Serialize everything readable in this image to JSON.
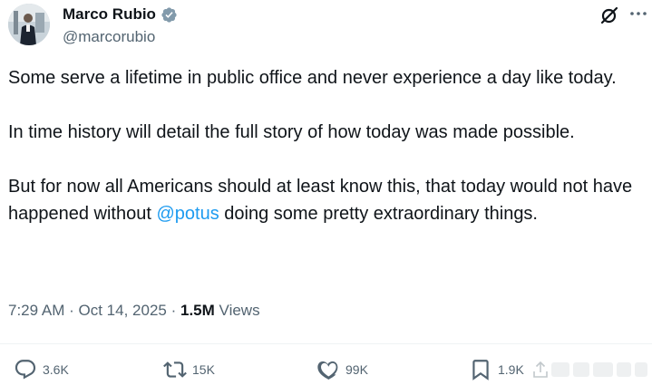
{
  "author": {
    "display_name": "Marco Rubio",
    "handle": "@marcorubio",
    "verified": true
  },
  "tweet": {
    "paragraph_1": "Some serve a lifetime in public office and never experience a day like today.",
    "paragraph_2": "In time history will detail the full story of how today was made possible.",
    "paragraph_3_before": "But for now all Americans should at least know this, that today would not have  happened without ",
    "mention": "@potus",
    "paragraph_3_after": " doing some pretty extraordinary things."
  },
  "meta": {
    "time": "7:29 AM",
    "separator": "·",
    "date": "Oct 14, 2025",
    "views_count": "1.5M",
    "views_label": "Views"
  },
  "actions": {
    "replies": "3.6K",
    "reposts": "15K",
    "likes": "99K",
    "bookmarks": "1.9K"
  },
  "icons": {
    "verified": "verified-badge-icon",
    "grok": "grok-icon",
    "more": "more-icon",
    "reply": "reply-icon",
    "repost": "repost-icon",
    "like": "like-icon",
    "bookmark": "bookmark-icon",
    "share": "share-icon"
  },
  "colors": {
    "text": "#0f1419",
    "secondary": "#536471",
    "link": "#1d9bf0",
    "verified": "#829aab"
  }
}
